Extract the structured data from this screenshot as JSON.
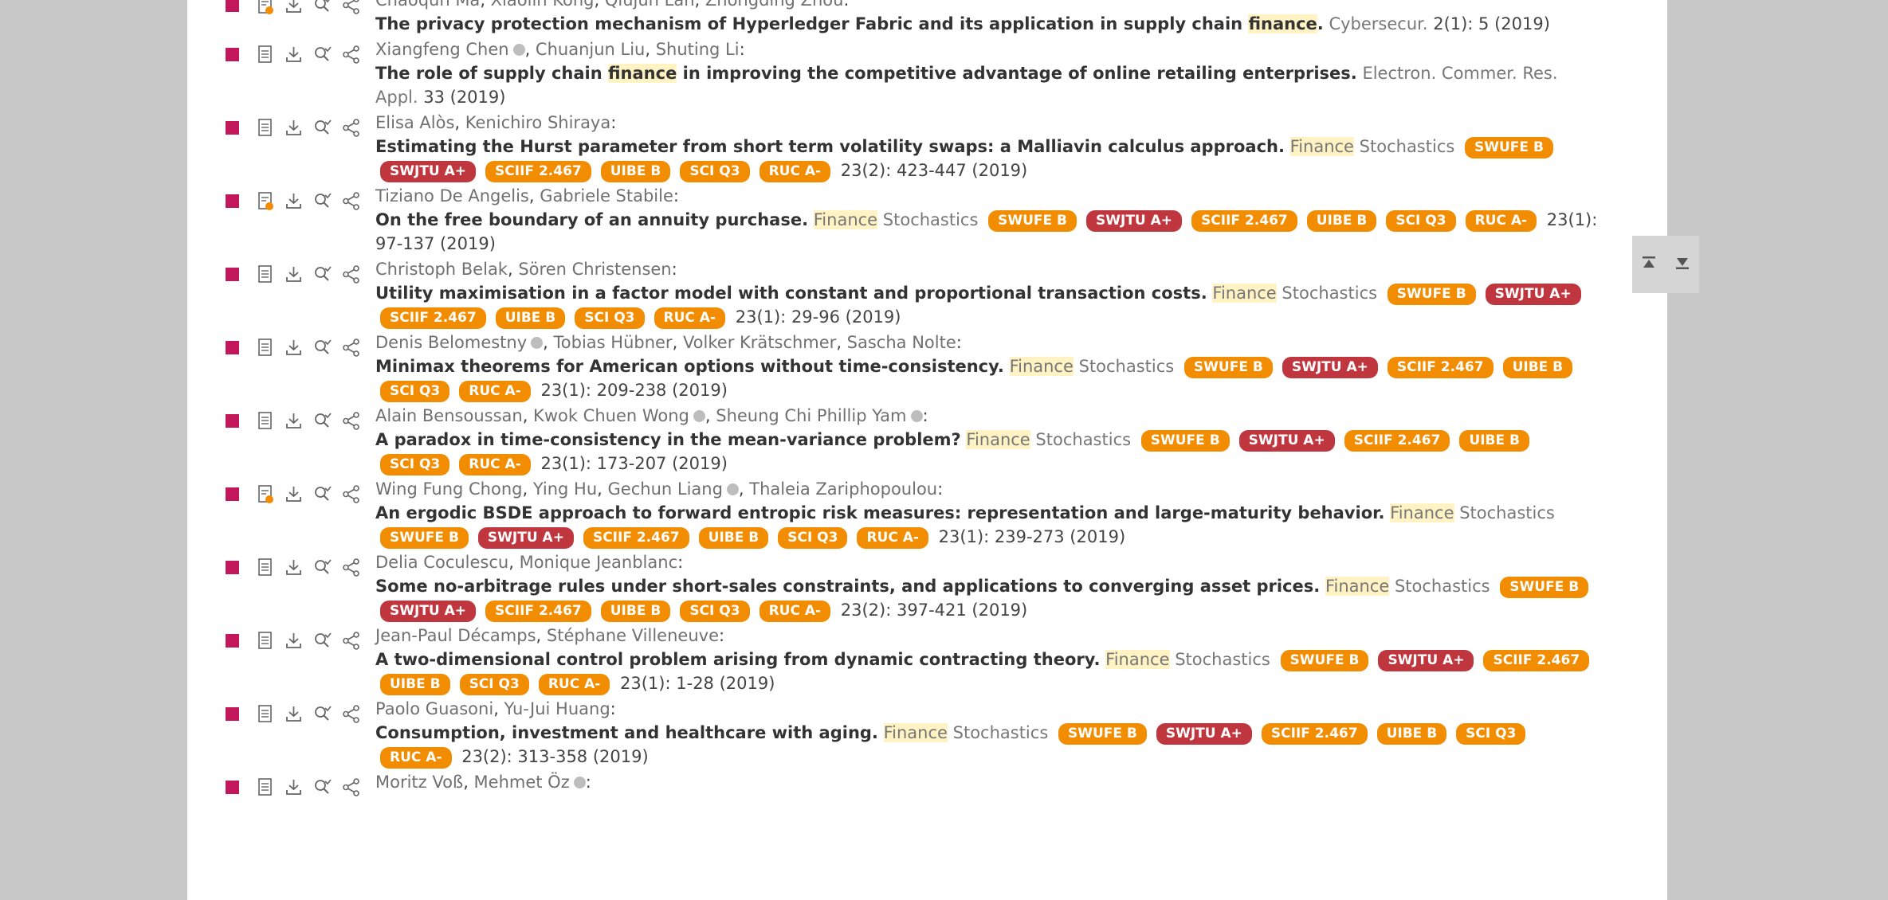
{
  "entries": [
    {
      "authors": [
        "Chaoqun Ma",
        "Xiaolin Kong",
        "Qiujun Lan",
        "Zhongding Zhou"
      ],
      "title_pre": "The privacy protection mechanism of Hyperledger Fabric and its application in supply chain ",
      "title_hl": "finance",
      "title_post": ".",
      "journal": "Cybersecur.",
      "volume": "2",
      "issue": "1",
      "pages": "5",
      "year": "(2019)",
      "badges": false,
      "pdf_icon": "paper-lock-icon"
    },
    {
      "authors": [
        "Xiangfeng Chen",
        "Chuanjun Liu",
        "Shuting Li"
      ],
      "title_pre": "The role of supply chain ",
      "title_hl": "finance",
      "title_post": " in improving the competitive advantage of online retailing enterprises.",
      "journal": "Electron. Commer. Res. Appl.",
      "volume": "33",
      "issue": "",
      "pages": "",
      "year": "(2019)",
      "badges": false,
      "pdf_icon": "paper-icon"
    },
    {
      "authors": [
        "Elisa Alòs",
        "Kenichiro Shiraya"
      ],
      "title_pre": "Estimating the Hurst parameter from short term volatility swaps: a Malliavin calculus approach.",
      "title_hl": "",
      "title_post": "",
      "journal_hl": "Finance",
      "journal": "Stochastics",
      "volume": "23",
      "issue": "2",
      "pages": "423-447",
      "year": "(2019)",
      "badges": true,
      "pdf_icon": "paper-icon"
    },
    {
      "authors": [
        "Tiziano De Angelis",
        "Gabriele Stabile"
      ],
      "title_pre": "On the free boundary of an annuity purchase.",
      "title_hl": "",
      "title_post": "",
      "journal_hl": "Finance",
      "journal": "Stochastics",
      "volume": "23",
      "issue": "1",
      "pages": "97-137",
      "year": "(2019)",
      "badges": true,
      "pdf_icon": "paper-lock-icon"
    },
    {
      "authors": [
        "Christoph Belak",
        "Sören Christensen"
      ],
      "title_pre": "Utility maximisation in a factor model with constant and proportional transaction costs.",
      "title_hl": "",
      "title_post": "",
      "journal_hl": "Finance",
      "journal": "Stochastics",
      "volume": "23",
      "issue": "1",
      "pages": "29-96",
      "year": "(2019)",
      "badges": true,
      "pdf_icon": "paper-icon"
    },
    {
      "authors": [
        "Denis Belomestny",
        "Tobias Hübner",
        "Volker Krätschmer",
        "Sascha Nolte"
      ],
      "title_pre": "Minimax theorems for American options without time-consistency.",
      "title_hl": "",
      "title_post": "",
      "journal_hl": "Finance",
      "journal": "Stochastics",
      "volume": "23",
      "issue": "1",
      "pages": "209-238",
      "year": "(2019)",
      "badges": true,
      "pdf_icon": "paper-icon"
    },
    {
      "authors": [
        "Alain Bensoussan",
        "Kwok Chuen Wong",
        "Sheung Chi Phillip Yam"
      ],
      "title_pre": "A paradox in time-consistency in the mean-variance problem?",
      "title_hl": "",
      "title_post": "",
      "journal_hl": "Finance",
      "journal": "Stochastics",
      "volume": "23",
      "issue": "1",
      "pages": "173-207",
      "year": "(2019)",
      "badges": true,
      "pdf_icon": "paper-icon"
    },
    {
      "authors": [
        "Wing Fung Chong",
        "Ying Hu",
        "Gechun Liang",
        "Thaleia Zariphopoulou"
      ],
      "title_pre": "An ergodic BSDE approach to forward entropic risk measures: representation and large-maturity behavior.",
      "title_hl": "",
      "title_post": "",
      "journal_hl": "Finance",
      "journal": "Stochastics",
      "volume": "23",
      "issue": "1",
      "pages": "239-273",
      "year": "(2019)",
      "badges": true,
      "pdf_icon": "paper-lock-icon"
    },
    {
      "authors": [
        "Delia Coculescu",
        "Monique Jeanblanc"
      ],
      "title_pre": "Some no-arbitrage rules under short-sales constraints, and applications to converging asset prices.",
      "title_hl": "",
      "title_post": "",
      "journal_hl": "Finance",
      "journal": "Stochastics",
      "volume": "23",
      "issue": "2",
      "pages": "397-421",
      "year": "(2019)",
      "badges": true,
      "pdf_icon": "paper-icon"
    },
    {
      "authors": [
        "Jean-Paul Décamps",
        "Stéphane Villeneuve"
      ],
      "title_pre": "A two-dimensional control problem arising from dynamic contracting theory.",
      "title_hl": "",
      "title_post": "",
      "journal_hl": "Finance",
      "journal": "Stochastics",
      "volume": "23",
      "issue": "1",
      "pages": "1-28",
      "year": "(2019)",
      "badges": true,
      "pdf_icon": "paper-icon"
    },
    {
      "authors": [
        "Paolo Guasoni",
        "Yu-Jui Huang"
      ],
      "title_pre": "Consumption, investment and healthcare with aging.",
      "title_hl": "",
      "title_post": "",
      "journal_hl": "Finance",
      "journal": "Stochastics",
      "volume": "23",
      "issue": "2",
      "pages": "313-358",
      "year": "(2019)",
      "badges": true,
      "pdf_icon": "paper-icon"
    },
    {
      "authors": [
        "Moritz Voß",
        "Mehmet Öz"
      ],
      "title_pre": "",
      "title_hl": "",
      "title_post": "",
      "journal": "",
      "volume": "",
      "issue": "",
      "pages": "",
      "year": "",
      "badges": false,
      "pdf_icon": "paper-icon"
    }
  ],
  "badge_labels": [
    "SWUFE B",
    "SWJTU A+",
    "SCIIF 2.467",
    "UIBE B",
    "SCI Q3",
    "RUC A-"
  ],
  "badge_colors": {
    "orange": "#f28c00",
    "red": "#c0363e"
  },
  "marker_color": "#c2185b",
  "orcid_authors": [
    "Xiangfeng Chen",
    "Denis Belomestny",
    "Kwok Chuen Wong",
    "Sheung Chi Phillip Yam",
    "Gechun Liang",
    "Mehmet Öz"
  ],
  "side_buttons": {
    "top_icon": "scroll-to-top-icon",
    "bottom_icon": "scroll-to-bottom-icon"
  }
}
